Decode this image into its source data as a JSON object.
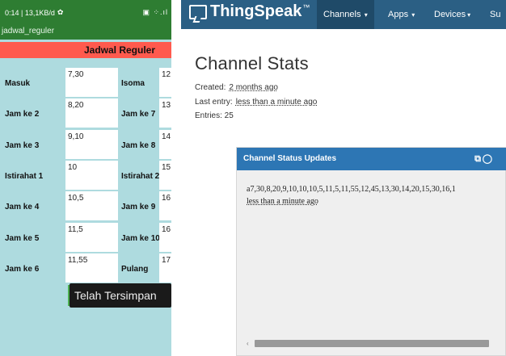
{
  "phone": {
    "status_text": "0:14 | 13,1KB/d",
    "status_icons": "▣ ⁘.ıl",
    "app_title": "jadwal_reguler",
    "header": "Jadwal Reguler",
    "rows": [
      {
        "l1": "Masuk",
        "v1": "7,30",
        "l2": "Isoma",
        "v2": "12"
      },
      {
        "l1": "Jam ke 2",
        "v1": "8,20",
        "l2": "Jam ke 7",
        "v2": "13"
      },
      {
        "l1": "Jam ke 3",
        "v1": "9,10",
        "l2": "Jam ke 8",
        "v2": "14"
      },
      {
        "l1": "Istirahat 1",
        "v1": "10",
        "l2": "Istirahat 2",
        "v2": "15"
      },
      {
        "l1": "Jam ke 4",
        "v1": "10,5",
        "l2": "Jam ke 9",
        "v2": "16"
      },
      {
        "l1": "Jam ke 5",
        "v1": "11,5",
        "l2": "Jam ke 10",
        "v2": "16"
      },
      {
        "l1": "Jam ke 6",
        "v1": "11,55",
        "l2": "Pulang",
        "v2": "17"
      }
    ],
    "toast": "Telah Tersimpan",
    "colors": {
      "status": "#2e7d32",
      "header": "#ff5a4e",
      "background": "#aedbdf"
    }
  },
  "ts": {
    "brand": "ThingSpeak",
    "brand_tm": "™",
    "nav": {
      "channels": "Channels",
      "apps": "Apps",
      "devices": "Devices",
      "support": "Su"
    },
    "page_title": "Channel Stats",
    "created_label": "Created:",
    "created_value": "2 months ago",
    "last_entry_label": "Last entry:",
    "last_entry_value": "less than a minute ago",
    "entries": "Entries: 25",
    "panel_title": "Channel Status Updates",
    "panel_icons": {
      "external": "external-link-icon",
      "comment": "comment-icon"
    },
    "update_text": "a7,30,8,20,9,10,10,10,5,11,5,11,55,12,45,13,30,14,20,15,30,16,1",
    "update_time": "less than a minute ago",
    "colors": {
      "navbar": "#2b5f84",
      "panel_head": "#2d76b4"
    }
  }
}
